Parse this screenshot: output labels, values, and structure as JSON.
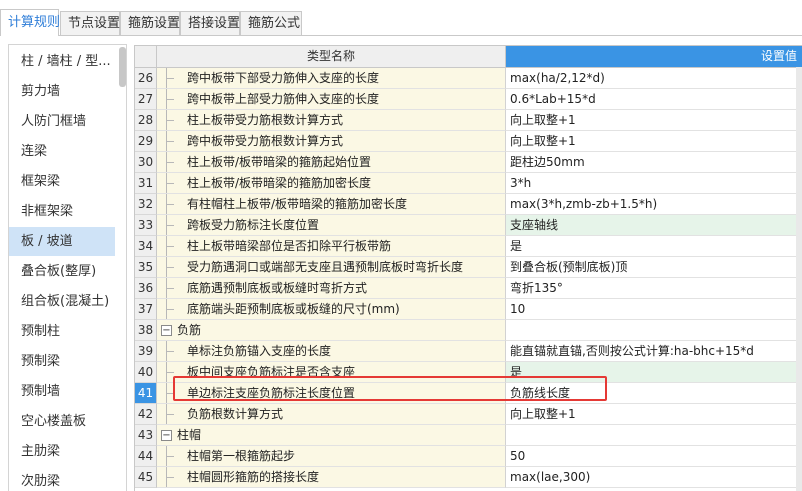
{
  "tabs": [
    {
      "label": "计算规则",
      "active": true
    },
    {
      "label": "节点设置",
      "active": false
    },
    {
      "label": "箍筋设置",
      "active": false
    },
    {
      "label": "搭接设置",
      "active": false
    },
    {
      "label": "箍筋公式",
      "active": false
    }
  ],
  "sidebar": {
    "items": [
      {
        "label": "柱 / 墙柱 / 型..."
      },
      {
        "label": "剪力墙"
      },
      {
        "label": "人防门框墙"
      },
      {
        "label": "连梁"
      },
      {
        "label": "框架梁"
      },
      {
        "label": "非框架梁"
      },
      {
        "label": "板 / 坡道",
        "selected": true
      },
      {
        "label": "叠合板(整厚)"
      },
      {
        "label": "组合板(混凝土)"
      },
      {
        "label": "预制柱"
      },
      {
        "label": "预制梁"
      },
      {
        "label": "预制墙"
      },
      {
        "label": "空心楼盖板"
      },
      {
        "label": "主肋梁"
      },
      {
        "label": "次肋梁"
      }
    ]
  },
  "table": {
    "header_name": "类型名称",
    "header_value": "设置值",
    "rows": [
      {
        "no": "26",
        "name": "跨中板带下部受力筋伸入支座的长度",
        "value": "max(ha/2,12*d)",
        "kind": "child"
      },
      {
        "no": "27",
        "name": "跨中板带上部受力筋伸入支座的长度",
        "value": "0.6*Lab+15*d",
        "kind": "child"
      },
      {
        "no": "28",
        "name": "柱上板带受力筋根数计算方式",
        "value": "向上取整+1",
        "kind": "child"
      },
      {
        "no": "29",
        "name": "跨中板带受力筋根数计算方式",
        "value": "向上取整+1",
        "kind": "child"
      },
      {
        "no": "30",
        "name": "柱上板带/板带暗梁的箍筋起始位置",
        "value": "距柱边50mm",
        "kind": "child"
      },
      {
        "no": "31",
        "name": "柱上板带/板带暗梁的箍筋加密长度",
        "value": "3*h",
        "kind": "child"
      },
      {
        "no": "32",
        "name": "有柱帽柱上板带/板带暗梁的箍筋加密长度",
        "value": "max(3*h,zmb-zb+1.5*h)",
        "kind": "child"
      },
      {
        "no": "33",
        "name": "跨板受力筋标注长度位置",
        "value": "支座轴线",
        "kind": "child",
        "green": true
      },
      {
        "no": "34",
        "name": "柱上板带暗梁部位是否扣除平行板带筋",
        "value": "是",
        "kind": "child"
      },
      {
        "no": "35",
        "name": "受力筋遇洞口或端部无支座且遇预制底板时弯折长度",
        "value": "到叠合板(预制底板)顶",
        "kind": "child"
      },
      {
        "no": "36",
        "name": "底筋遇预制底板或板缝时弯折方式",
        "value": "弯折135°",
        "kind": "child"
      },
      {
        "no": "37",
        "name": "底筋端头距预制底板或板缝的尺寸(mm)",
        "value": "10",
        "kind": "child"
      },
      {
        "no": "38",
        "name": "负筋",
        "value": "",
        "kind": "group"
      },
      {
        "no": "39",
        "name": "单标注负筋锚入支座的长度",
        "value": "能直锚就直锚,否则按公式计算:ha-bhc+15*d",
        "kind": "child"
      },
      {
        "no": "40",
        "name": "板中间支座负筋标注是否含支座",
        "value": "是",
        "kind": "child",
        "green": true
      },
      {
        "no": "41",
        "name": "单边标注支座负筋标注长度位置",
        "value": "负筋线长度",
        "kind": "child",
        "selected": true
      },
      {
        "no": "42",
        "name": "负筋根数计算方式",
        "value": "向上取整+1",
        "kind": "child"
      },
      {
        "no": "43",
        "name": "柱帽",
        "value": "",
        "kind": "group"
      },
      {
        "no": "44",
        "name": "柱帽第一根箍筋起步",
        "value": "50",
        "kind": "child"
      },
      {
        "no": "45",
        "name": "柱帽圆形箍筋的搭接长度",
        "value": "max(lae,300)",
        "kind": "child"
      }
    ]
  },
  "colors": {
    "accent": "#3a94e4",
    "name_column_bg": "#fbf8e4",
    "highlight_border": "#e53935",
    "selected_sidebar": "#cfe3f7"
  },
  "icons": {
    "group_toggle": "minus-box-icon"
  }
}
